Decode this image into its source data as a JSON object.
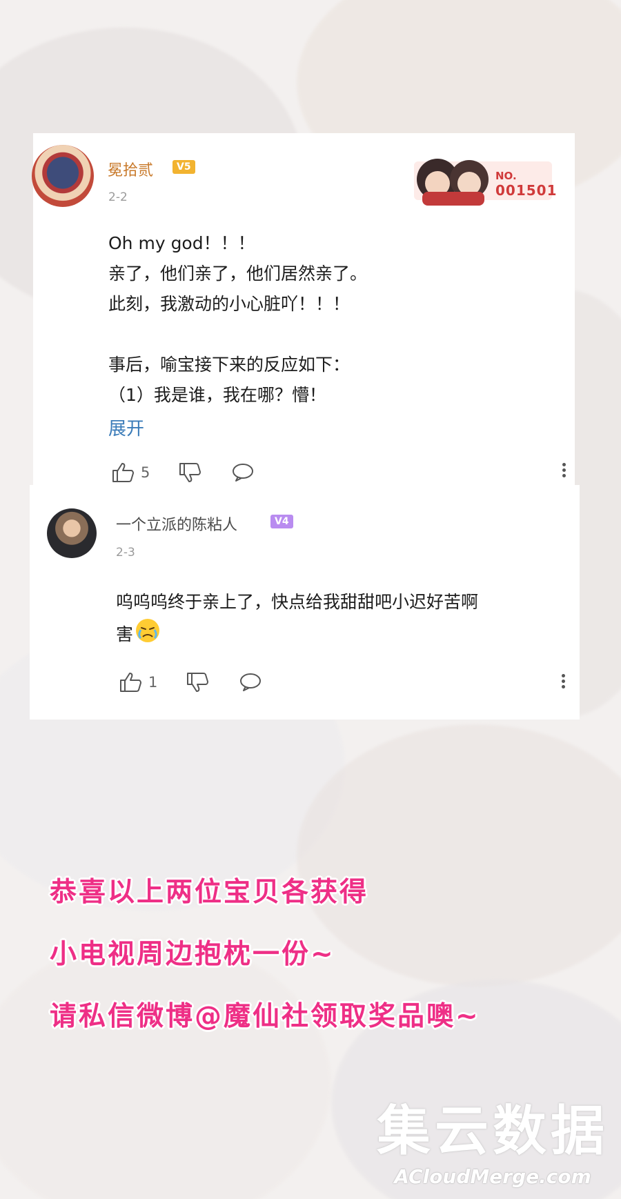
{
  "comments": [
    {
      "username": "冕拾贰",
      "level": "V5",
      "date": "2-2",
      "fan_badge": {
        "prefix": "NO.",
        "number": "001501"
      },
      "lines": [
        "Oh my god！！！",
        "亲了，他们亲了，他们居然亲了。",
        "此刻，我激动的小心脏吖！！！",
        "",
        "事后，喻宝接下来的反应如下：",
        "（1）我是谁，我在哪？懵！"
      ],
      "expand_label": "展开",
      "like_count": "5"
    },
    {
      "username": "一个立派的陈粘人",
      "level": "V4",
      "date": "2-3",
      "lines": [
        "呜呜呜终于亲上了，快点给我甜甜吧小迟好苦啊",
        "害"
      ],
      "emoji": "crying-emoji",
      "like_count": "1"
    }
  ],
  "promo": [
    "恭喜以上两位宝贝各获得",
    "小电视周边抱枕一份~",
    "请私信微博@魔仙社领取奖品噢~"
  ],
  "watermark": {
    "cn": "集云数据",
    "en": "ACloudMerge.com"
  },
  "colors": {
    "promo": "#ee2f86",
    "link": "#3a7bb8",
    "v5": "#f2b330",
    "v4": "#b98cf0"
  }
}
